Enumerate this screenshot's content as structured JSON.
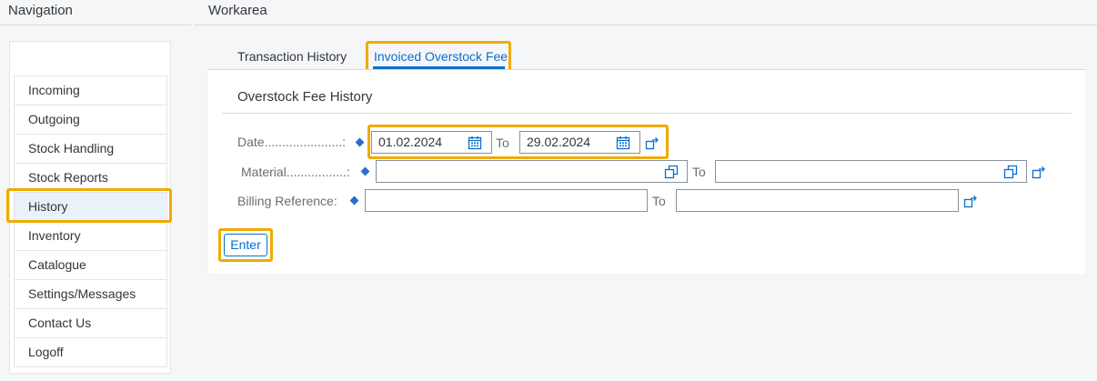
{
  "header": {
    "navigation_title": "Navigation",
    "workarea_title": "Workarea"
  },
  "sidebar": {
    "items": [
      {
        "label": "Incoming"
      },
      {
        "label": "Outgoing"
      },
      {
        "label": "Stock Handling"
      },
      {
        "label": "Stock Reports"
      },
      {
        "label": "History"
      },
      {
        "label": "Inventory"
      },
      {
        "label": "Catalogue"
      },
      {
        "label": "Settings/Messages"
      },
      {
        "label": "Contact Us"
      },
      {
        "label": "Logoff"
      }
    ],
    "selected": "History"
  },
  "tabs": [
    {
      "label": "Transaction History"
    },
    {
      "label": "Invoiced Overstock Fee"
    }
  ],
  "active_tab": "Invoiced Overstock Fee",
  "form": {
    "title": "Overstock Fee History",
    "date_label": "Date......................:",
    "date_from": "01.02.2024",
    "date_to": "29.02.2024",
    "material_label": "Material.................:",
    "material_from": "",
    "material_to": "",
    "billing_label": "Billing Reference:",
    "billing_from": "",
    "billing_to": "",
    "to_label": "To",
    "enter_label": "Enter"
  },
  "colors": {
    "accent": "#0a6ed1",
    "highlight": "#f0ab00",
    "required": "#2d6ccf"
  }
}
